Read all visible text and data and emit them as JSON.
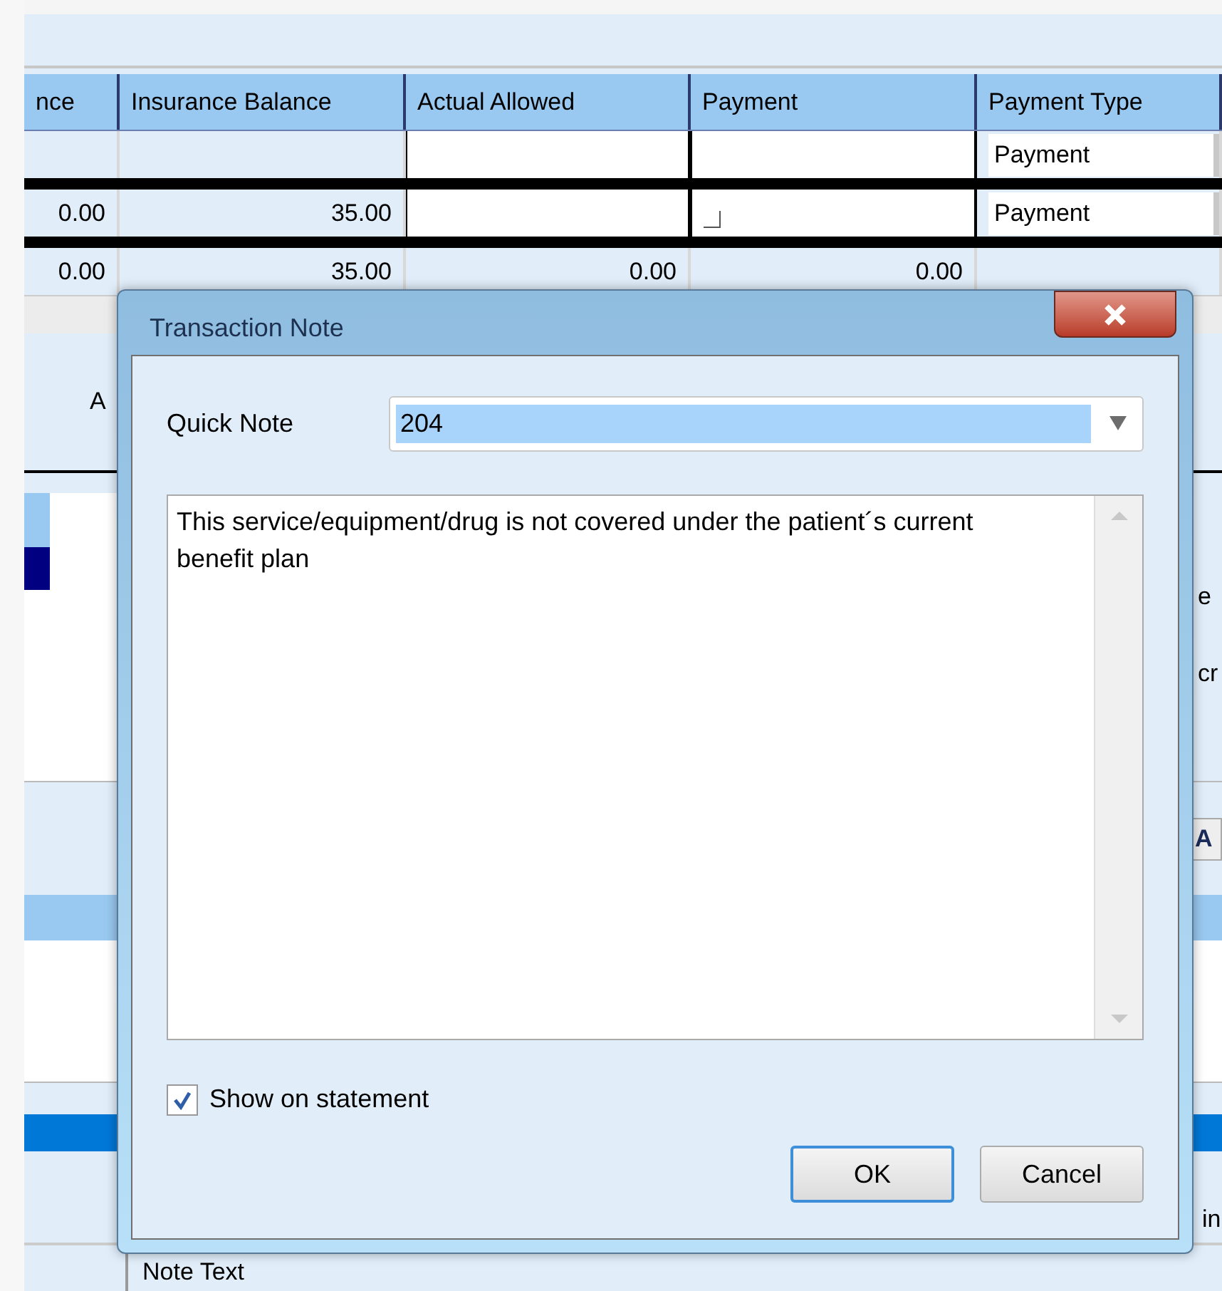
{
  "grid": {
    "columns": [
      "nce",
      "Insurance Balance",
      "Actual Allowed",
      "Payment",
      "Payment Type"
    ],
    "rows": [
      {
        "cells": [
          {
            "kind": "blank"
          },
          {
            "kind": "blank"
          },
          {
            "kind": "input"
          },
          {
            "kind": "input"
          },
          {
            "kind": "dropdown",
            "text": "Payment"
          }
        ]
      },
      {
        "cells": [
          {
            "kind": "text",
            "text": "0.00"
          },
          {
            "kind": "text",
            "text": "35.00"
          },
          {
            "kind": "input"
          },
          {
            "kind": "input",
            "corner": true
          },
          {
            "kind": "dropdown",
            "text": "Payment"
          }
        ]
      },
      {
        "cells": [
          {
            "kind": "text",
            "text": "0.00"
          },
          {
            "kind": "text",
            "text": "35.00"
          },
          {
            "kind": "text",
            "text": "0.00"
          },
          {
            "kind": "text",
            "text": "0.00"
          },
          {
            "kind": "blank"
          }
        ]
      }
    ]
  },
  "panel_tab": "A",
  "side_fragments": [
    "e",
    "cr"
  ],
  "side_button": "A",
  "bottom_fragment": "in",
  "notes_column": "Note Text",
  "dialog": {
    "title": "Transaction Note",
    "quick_note": {
      "label": "Quick Note",
      "value": "204"
    },
    "note_text": "This service/equipment/drug is not covered under the patient´s current benefit plan",
    "show_on_statement": {
      "label": "Show on statement",
      "checked": true
    },
    "buttons": [
      {
        "label": "OK",
        "default": true
      },
      {
        "label": "Cancel",
        "default": false
      }
    ]
  }
}
